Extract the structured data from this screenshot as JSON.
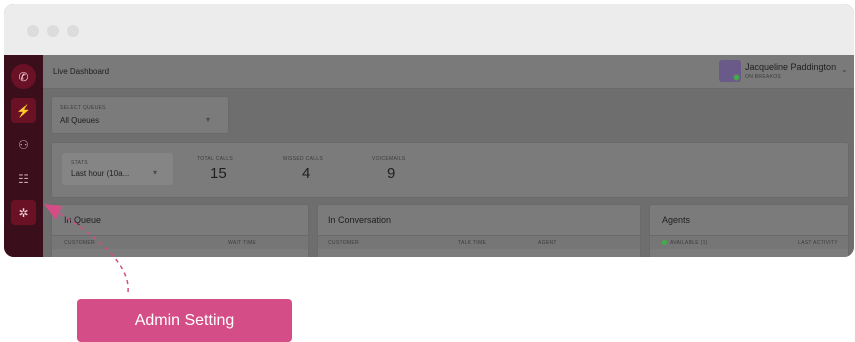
{
  "titlebar": {
    "dots": [
      "close",
      "minimize",
      "maximize"
    ]
  },
  "sidebar": {
    "items": [
      {
        "name": "logo",
        "icon": "phone-icon",
        "glyph": "✆"
      },
      {
        "name": "live",
        "icon": "lightning-icon",
        "glyph": "⚡"
      },
      {
        "name": "agents",
        "icon": "people-icon",
        "glyph": "⚇"
      },
      {
        "name": "reports",
        "icon": "list-icon",
        "glyph": "☷"
      },
      {
        "name": "settings",
        "icon": "gear-icon",
        "glyph": "✲"
      }
    ]
  },
  "header": {
    "title": "Live Dashboard",
    "user_name": "Jacqueline Paddington",
    "user_status": "ON BREAKOS",
    "chevron": "⌄"
  },
  "queue_select": {
    "label": "SELECT QUEUES",
    "value": "All Queues",
    "caret": "▾"
  },
  "stats": {
    "period_label": "STATS",
    "period_value": "Last hour (10a...",
    "caret": "▾",
    "total_calls_label": "TOTAL CALLS",
    "total_calls": "15",
    "missed_calls_label": "MISSED CALLS",
    "missed_calls": "4",
    "voicemails_label": "VOICEMAILS",
    "voicemails": "9"
  },
  "panels": {
    "in_queue": {
      "title": "In Queue",
      "col1": "CUSTOMER",
      "col2": "WAIT TIME"
    },
    "in_conversation": {
      "title": "In Conversation",
      "col1": "CUSTOMER",
      "col2": "TALK TIME",
      "col3": "AGENT"
    },
    "agents": {
      "title": "Agents",
      "col1": "AVAILABLE (1)",
      "col2": "LAST ACTIVITY"
    }
  },
  "callout": {
    "label": "Admin Setting"
  },
  "colors": {
    "accent": "#d44d86",
    "sidebar": "#3a0f1b",
    "available": "#3fae49"
  }
}
